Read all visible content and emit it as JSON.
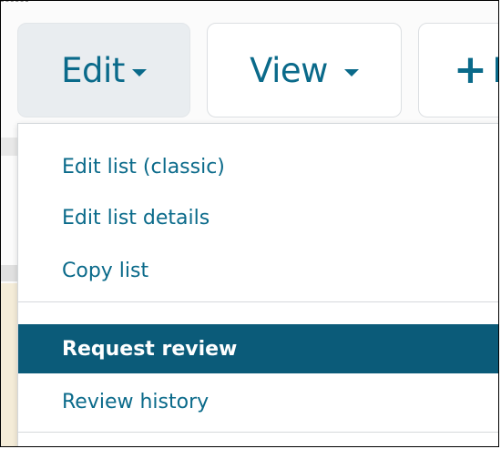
{
  "toolbar": {
    "edit_label": "Edit",
    "view_label": "View",
    "new_label": "N"
  },
  "menu": {
    "items": [
      {
        "label": "Edit list (classic)"
      },
      {
        "label": "Edit list details"
      },
      {
        "label": "Copy list"
      },
      {
        "label": "Request review",
        "selected": true
      },
      {
        "label": "Review history"
      }
    ]
  },
  "colors": {
    "accent": "#0a6a8a",
    "selected_bg": "#0b5b79"
  }
}
